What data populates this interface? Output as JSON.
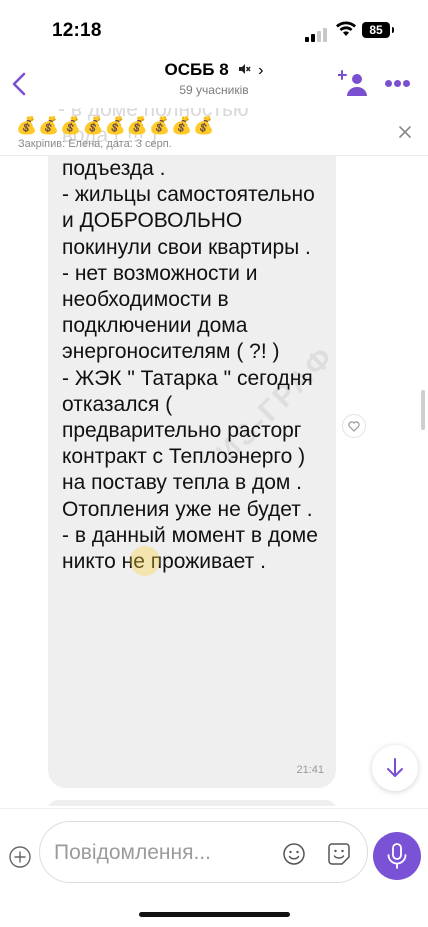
{
  "status_bar": {
    "time": "12:18",
    "battery": "85"
  },
  "header": {
    "title": "ОСББ 8",
    "chevron": "›",
    "subtitle": "59 учасників",
    "accent": "#7b50d0"
  },
  "pinned": {
    "text": "💰💰💰💰💰💰💰💰💰",
    "meta": "Закріпив: Елена, дата: 3 серп.",
    "ghost_line1": "- в доме полностью",
    "ghost_line2": "вода ( !!! )"
  },
  "message": {
    "text": "подъезда .\n- жильцы самостоятельно и ДОБРОВОЛЬНО покинули свои квартиры .\n- нет возможности и необходимости в подключении дома энергоносителям ( ?! )\n- ЖЭК \" Татарка \" сегодня отказался ( предварительно расторг контракт с Теплоэнерго ) на поставу тепла в дом . Отопления уже не будет .\n- в данный момент в доме никто не проживает .",
    "time": "21:41",
    "watermark": "ИЗ-ГРАФ"
  },
  "composer": {
    "placeholder": "Повідомлення...",
    "mic_color": "#7a52d6"
  },
  "icons": [
    "back-icon",
    "muted-icon",
    "add-member-icon",
    "more-icon",
    "close-icon",
    "heart-icon",
    "arrow-down-icon",
    "plus-icon",
    "emoji-icon",
    "sticker-icon",
    "microphone-icon"
  ]
}
